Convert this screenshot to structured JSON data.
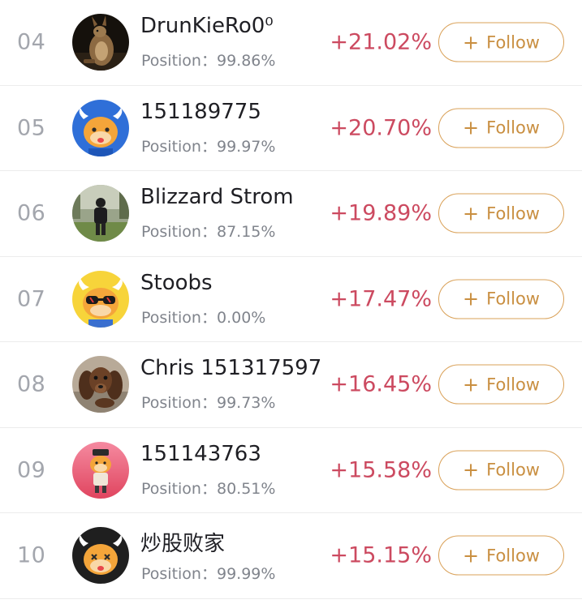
{
  "leaderboard": {
    "position_label": "Position：",
    "follow_plus": "+",
    "follow_label": "Follow",
    "rows": [
      {
        "rank": "04",
        "name": "DrunKieRo0⁰",
        "position": "99.86%",
        "change": "+21.02%",
        "avatar": "kangaroo-photo-avatar"
      },
      {
        "rank": "05",
        "name": "151189775",
        "position": "99.97%",
        "change": "+20.70%",
        "avatar": "bull-cartoon-avatar-blue"
      },
      {
        "rank": "06",
        "name": "Blizzard Strom",
        "position": "87.15%",
        "change": "+19.89%",
        "avatar": "person-photo-avatar"
      },
      {
        "rank": "07",
        "name": "Stoobs",
        "position": "0.00%",
        "change": "+17.47%",
        "avatar": "bull-sunglasses-avatar-yellow"
      },
      {
        "rank": "08",
        "name": "Chris 151317597",
        "position": "99.73%",
        "change": "+16.45%",
        "avatar": "dog-photo-avatar"
      },
      {
        "rank": "09",
        "name": "151143763",
        "position": "80.51%",
        "change": "+15.58%",
        "avatar": "bull-figure-avatar-pink"
      },
      {
        "rank": "10",
        "name": "炒股败家",
        "position": "99.99%",
        "change": "+15.15%",
        "avatar": "bull-cartoon-avatar-dark"
      }
    ]
  },
  "colors": {
    "gain": "#cc4a60",
    "follow_accent": "#d9a057",
    "rank": "#a3a6ad"
  }
}
